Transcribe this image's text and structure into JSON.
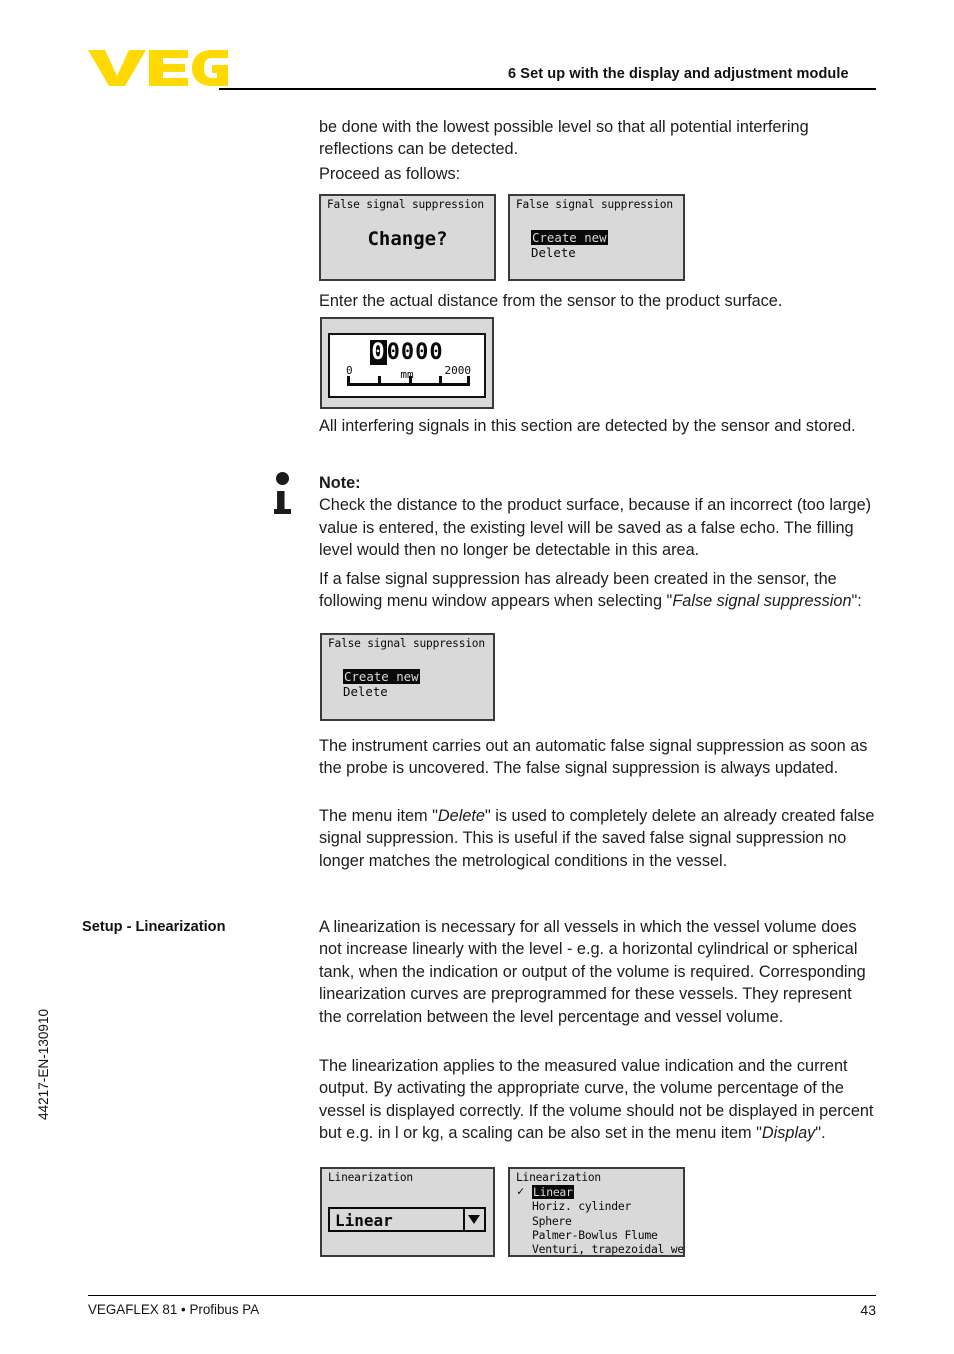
{
  "header": {
    "logo_text": "VEGA",
    "logo_color": "#ffd900",
    "chapter_title": "6 Set up with the display and adjustment module"
  },
  "footer": {
    "left": "VEGAFLEX 81 • Profibus PA",
    "page_number": "43",
    "doc_id": "44217-EN-130910"
  },
  "body": {
    "p_intro": "be done with the lowest possible level so that all potential interfering reflections can be detected.",
    "p_proceed": "Proceed as follows:",
    "p_enter_distance": "Enter the actual distance from the sensor to the product surface.",
    "p_all_signals": "All interfering signals in this section are detected by the sensor and stored.",
    "note_title": "Note:",
    "p_note": "Check the distance to the product surface, because if an incorrect (too large) value is entered, the existing level will be saved as a false echo. The filling level would then no longer be detectable in this area.",
    "p_already_created_1": "If a false signal suppression has already been created in the sensor, the following menu window appears when selecting \"",
    "p_already_created_em": "False signal suppression",
    "p_already_created_2": "\":",
    "p_automatic": "The instrument carries out an automatic false signal suppression as soon as the probe is uncovered. The false signal suppression is always updated.",
    "p_delete_1": "The menu item \"",
    "p_delete_em": "Delete",
    "p_delete_2": "\" is used to completely delete an already created false signal suppression. This is useful if the saved false signal suppression no longer matches the metrological conditions in the vessel.",
    "side_heading_linearization": "Setup - Linearization",
    "p_lin_1": "A linearization is necessary for all vessels in which the vessel volume does not increase linearly with the level - e.g. a horizontal cylindrical or spherical tank, when the indication or output of the volume is required. Corresponding linearization curves are preprogrammed for these vessels. They represent the correlation between the level percentage and vessel volume.",
    "p_lin_2_a": "The linearization applies to the measured value indication and the current output. By activating the appropriate curve, the volume percentage of the vessel is displayed correctly. If the volume should not be displayed in percent but e.g. in l or kg, a scaling can be also set in the menu item \"",
    "p_lin_2_em": "Display",
    "p_lin_2_b": "\"."
  },
  "displays": {
    "fss_change": {
      "title": "False signal suppression",
      "center_text": "Change?"
    },
    "fss_menu_top": {
      "title": "False signal suppression",
      "items": [
        {
          "label": "Create new",
          "selected": true
        },
        {
          "label": "Delete",
          "selected": false
        }
      ]
    },
    "distance_entry": {
      "digits": "00000",
      "cursor_index": 0,
      "unit": "mm",
      "scale_min": "0",
      "scale_max": "2000"
    },
    "fss_menu_second": {
      "title": "False signal suppression",
      "items": [
        {
          "label": "Create new",
          "selected": true
        },
        {
          "label": "Delete",
          "selected": false
        }
      ]
    },
    "linearization_combo": {
      "title": "Linearization",
      "value": "Linear",
      "arrow_icon": "chevron-down-icon"
    },
    "linearization_list": {
      "title": "Linearization",
      "items": [
        {
          "label": "Linear",
          "selected": true,
          "checked": true
        },
        {
          "label": "Horiz. cylinder",
          "selected": false,
          "checked": false
        },
        {
          "label": "Sphere",
          "selected": false,
          "checked": false
        },
        {
          "label": "Palmer-Bowlus Flume",
          "selected": false,
          "checked": false
        },
        {
          "label": "Venturi, trapezoidal weir",
          "selected": false,
          "checked": false
        }
      ],
      "more_indicator": "▼"
    }
  }
}
